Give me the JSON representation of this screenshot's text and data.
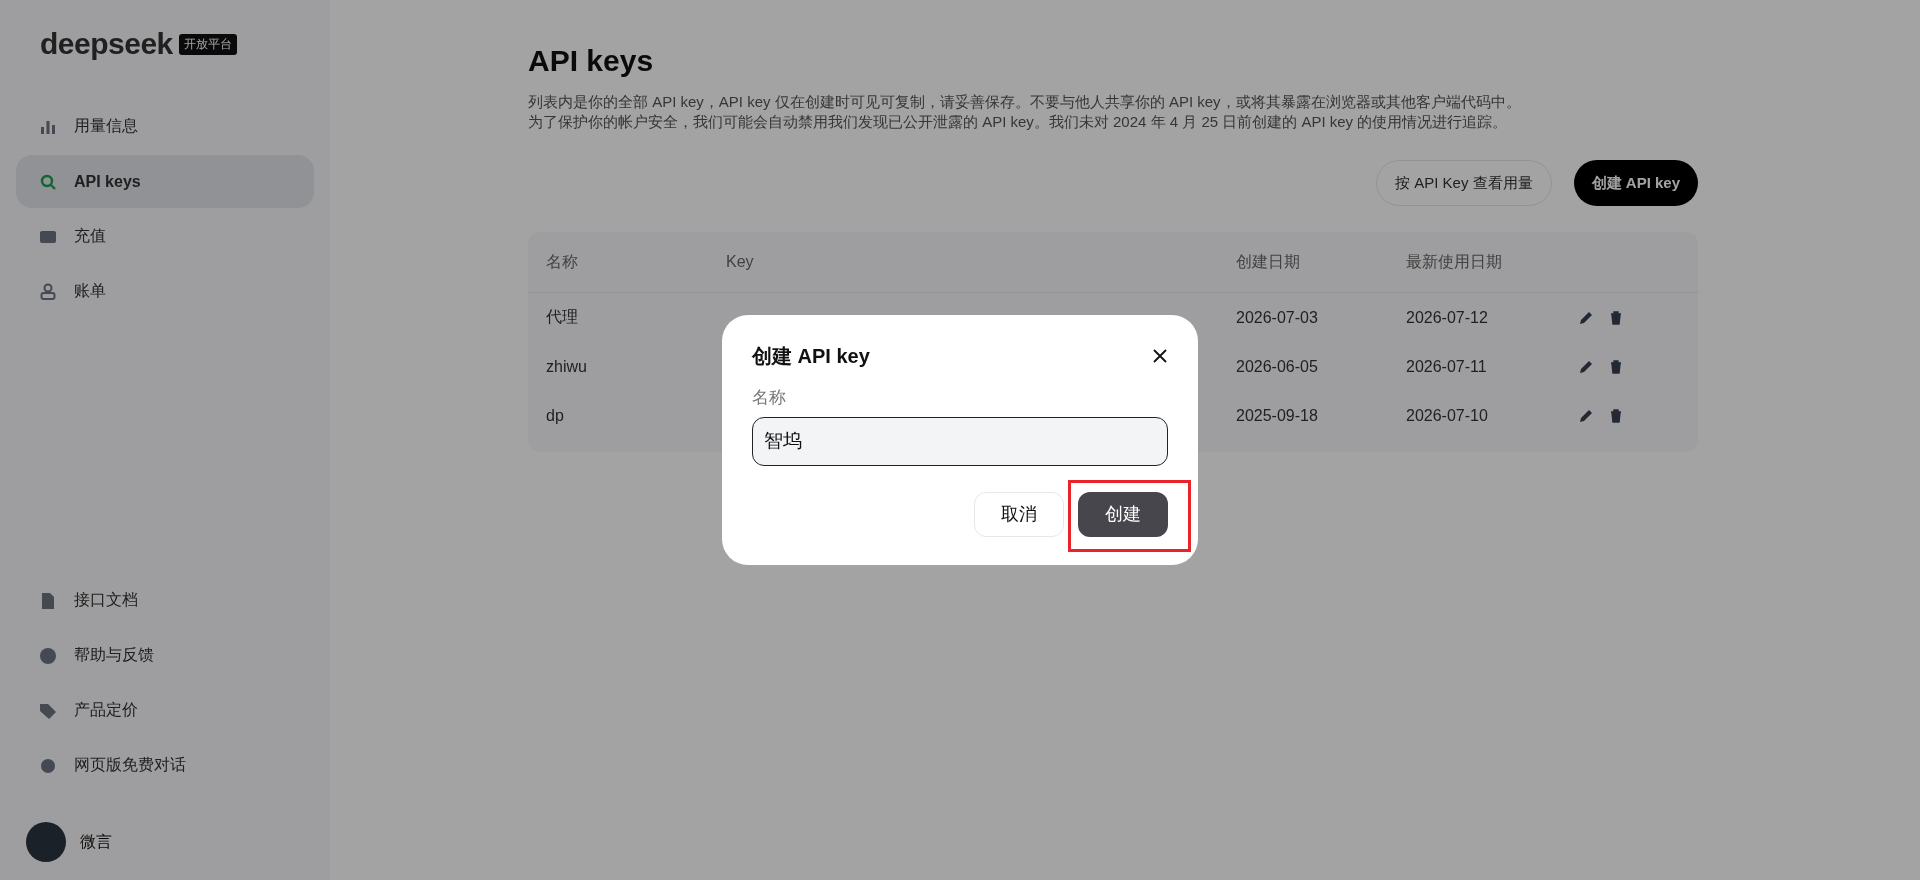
{
  "sidebar": {
    "logo": "deepseek",
    "logo_badge": "开放平台",
    "top_items": [
      {
        "label": "用量信息",
        "selected": false
      },
      {
        "label": "API keys",
        "selected": true
      },
      {
        "label": "充值",
        "selected": false
      },
      {
        "label": "账单",
        "selected": false
      }
    ],
    "bottom_items": [
      {
        "label": "接口文档"
      },
      {
        "label": "帮助与反馈"
      },
      {
        "label": "产品定价"
      },
      {
        "label": "网页版免费对话"
      }
    ],
    "user": {
      "name": "微言"
    }
  },
  "page": {
    "title": "API keys",
    "description": [
      "列表内是你的全部 API key，API key 仅在创建时可见可复制，请妥善保存。不要与他人共享你的 API key，或将其暴露在浏览器或其他客户端代码中。",
      "为了保护你的帐户安全，我们可能会自动禁用我们发现已公开泄露的 API key。我们未对 2024 年 4 月 25 日前创建的 API key 的使用情况进行追踪。"
    ],
    "buttons": [
      {
        "label": "按 API Key 查看用量",
        "kind": "secondary"
      },
      {
        "label": "创建 API key",
        "kind": "primary"
      }
    ]
  },
  "table": {
    "columns": [
      "名称",
      "Key",
      "创建日期",
      "最新使用日期"
    ],
    "rows": [
      {
        "name": "代理",
        "created": "2026-07-03",
        "last_used": "2026-07-12"
      },
      {
        "name": "zhiwu",
        "created": "2026-06-05",
        "last_used": "2026-07-11"
      },
      {
        "name": "dp",
        "created": "2025-09-18",
        "last_used": "2026-07-10"
      }
    ]
  },
  "dialog": {
    "title": "创建 API key",
    "field_label": "名称",
    "field_value": "智坞",
    "buttons": [
      {
        "label": "取消",
        "kind": "secondary",
        "highlighted": false
      },
      {
        "label": "创建",
        "kind": "primary",
        "highlighted": true
      }
    ]
  }
}
